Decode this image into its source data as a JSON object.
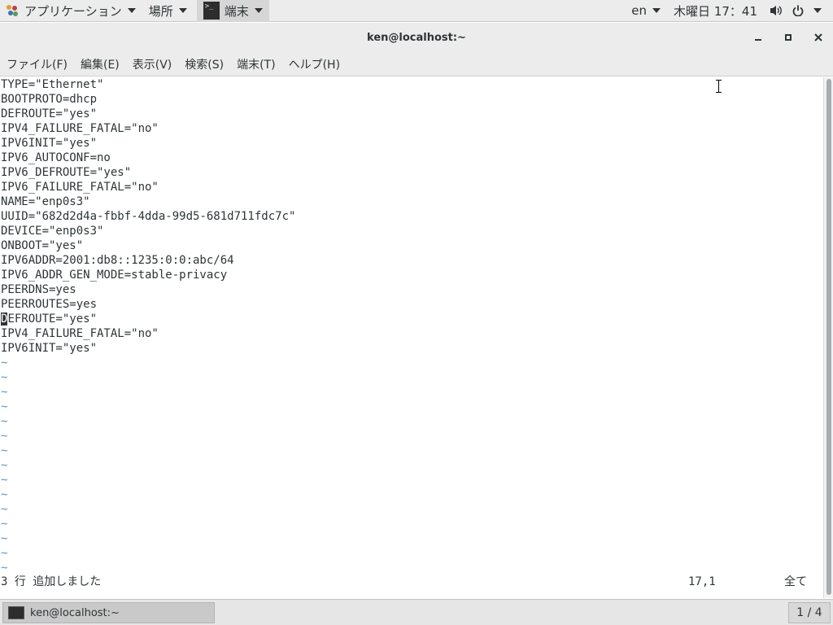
{
  "topbar": {
    "apps_label": "アプリケーション",
    "places_label": "場所",
    "terminal_label": "端末",
    "lang": "en",
    "clock": "木曜日 17：41",
    "volume_icon": "volume-icon",
    "power_icon": "power-icon"
  },
  "window": {
    "title": "ken@localhost:~",
    "minimize_icon": "minimize-icon",
    "maximize_icon": "maximize-icon",
    "close_icon": "close-icon"
  },
  "menu": [
    "ファイル(F)",
    "編集(E)",
    "表示(V)",
    "検索(S)",
    "端末(T)",
    "ヘルプ(H)"
  ],
  "editor": {
    "lines": [
      "TYPE=\"Ethernet\"",
      "BOOTPROTO=dhcp",
      "DEFROUTE=\"yes\"",
      "IPV4_FAILURE_FATAL=\"no\"",
      "IPV6INIT=\"yes\"",
      "IPV6_AUTOCONF=no",
      "IPV6_DEFROUTE=\"yes\"",
      "IPV6_FAILURE_FATAL=\"no\"",
      "NAME=\"enp0s3\"",
      "UUID=\"682d2d4a-fbbf-4dda-99d5-681d711fdc7c\"",
      "DEVICE=\"enp0s3\"",
      "ONBOOT=\"yes\"",
      "IPV6ADDR=2001:db8::1235:0:0:abc/64",
      "IPV6_ADDR_GEN_MODE=stable-privacy",
      "PEERDNS=yes",
      "PEERROUTES=yes",
      "DEFROUTE=\"yes\"",
      "IPV4_FAILURE_FATAL=\"no\"",
      "IPV6INIT=\"yes\""
    ],
    "cursor_line": 16,
    "tilde": "~",
    "tilde_count": 15,
    "status_message": "3 行 追加しました",
    "cursor_position": "17,1",
    "scroll_status": "全て"
  },
  "taskbar": {
    "task_label": "ken@localhost:~",
    "workspace": "1 / 4"
  }
}
